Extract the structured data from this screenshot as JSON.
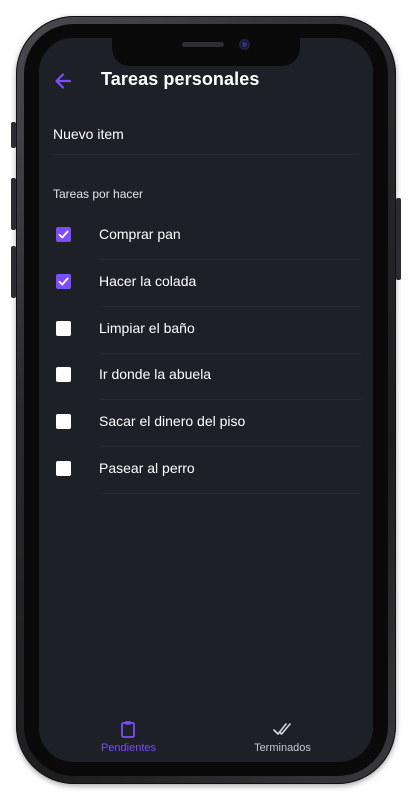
{
  "app": {
    "title": "Tareas personales"
  },
  "new_item": {
    "placeholder": "Nuevo item"
  },
  "section": {
    "label": "Tareas por hacer"
  },
  "tasks": [
    {
      "label": "Comprar pan",
      "checked": true
    },
    {
      "label": "Hacer la colada",
      "checked": true
    },
    {
      "label": "Limpiar el baño",
      "checked": false
    },
    {
      "label": "Ir donde la abuela",
      "checked": false
    },
    {
      "label": "Sacar el dinero del piso",
      "checked": false
    },
    {
      "label": "Pasear al perro",
      "checked": false
    }
  ],
  "nav": {
    "pending_label": "Pendientes",
    "done_label": "Terminados",
    "active": "pending"
  },
  "colors": {
    "accent": "#7c4dff",
    "background": "#1d2027",
    "text": "#ffffff"
  },
  "icons": {
    "back": "arrow-left-icon",
    "pending": "clipboard-icon",
    "done": "double-check-icon"
  }
}
